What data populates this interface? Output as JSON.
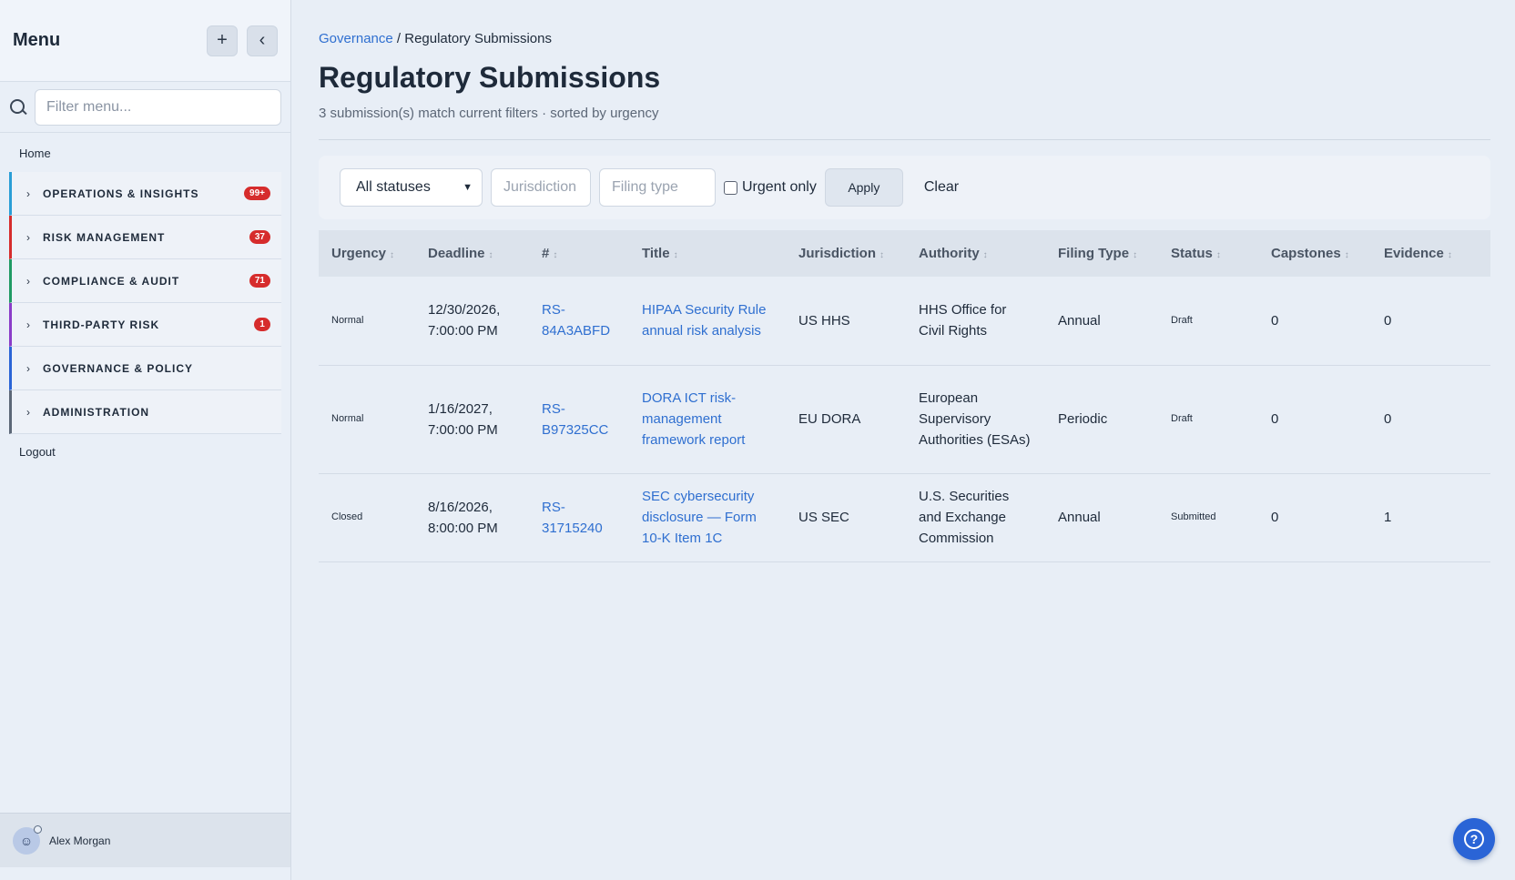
{
  "sidebar": {
    "title": "Menu",
    "add_icon": "+",
    "collapse_icon": "‹",
    "filter_placeholder": "Filter menu...",
    "home": "Home",
    "groups": [
      {
        "label": "OPERATIONS & INSIGHTS",
        "badge": "99+",
        "color": "#2a9ed6"
      },
      {
        "label": "RISK MANAGEMENT",
        "badge": "37",
        "color": "#d62c2c"
      },
      {
        "label": "COMPLIANCE & AUDIT",
        "badge": "71",
        "color": "#1f9a64"
      },
      {
        "label": "THIRD-PARTY RISK",
        "badge": "1",
        "color": "#8a3cc8"
      },
      {
        "label": "GOVERNANCE & POLICY",
        "badge": "",
        "color": "#2a64d6"
      },
      {
        "label": "ADMINISTRATION",
        "badge": "",
        "color": "#5c6777"
      }
    ],
    "logout": "Logout",
    "user": "Alex Morgan"
  },
  "breadcrumb": {
    "parent": "Governance",
    "sep": "/",
    "current": "Regulatory Submissions"
  },
  "page": {
    "title": "Regulatory Submissions",
    "subtitle": "3 submission(s) match current filters · sorted by urgency"
  },
  "filters": {
    "status_value": "All statuses",
    "jurisdiction_placeholder": "Jurisdiction",
    "filing_type_placeholder": "Filing type",
    "urgent_label": "Urgent only",
    "apply": "Apply",
    "clear": "Clear"
  },
  "table": {
    "headers": [
      "Urgency",
      "Deadline",
      "#",
      "Title",
      "Jurisdiction",
      "Authority",
      "Filing Type",
      "Status",
      "Capstones",
      "Evidence"
    ],
    "rows": [
      {
        "urgency": "Normal",
        "deadline": "12/30/2026, 7:00:00 PM",
        "id": "RS-84A3ABFD",
        "title": "HIPAA Security Rule annual risk analysis",
        "jurisdiction": "US HHS",
        "authority": "HHS Office for Civil Rights",
        "filing_type": "Annual",
        "status": "Draft",
        "capstones": "0",
        "evidence": "0"
      },
      {
        "urgency": "Normal",
        "deadline": "1/16/2027, 7:00:00 PM",
        "id": "RS-B97325CC",
        "title": "DORA ICT risk-management framework report",
        "jurisdiction": "EU DORA",
        "authority": "European Supervisory Authorities (ESAs)",
        "filing_type": "Periodic",
        "status": "Draft",
        "capstones": "0",
        "evidence": "0"
      },
      {
        "urgency": "Closed",
        "deadline": "8/16/2026, 8:00:00 PM",
        "id": "RS-31715240",
        "title": "SEC cybersecurity disclosure — Form 10-K Item 1C",
        "jurisdiction": "US SEC",
        "authority": "U.S. Securities and Exchange Commission",
        "filing_type": "Annual",
        "status": "Submitted",
        "capstones": "0",
        "evidence": "1"
      }
    ]
  },
  "help": {
    "icon": "?"
  }
}
